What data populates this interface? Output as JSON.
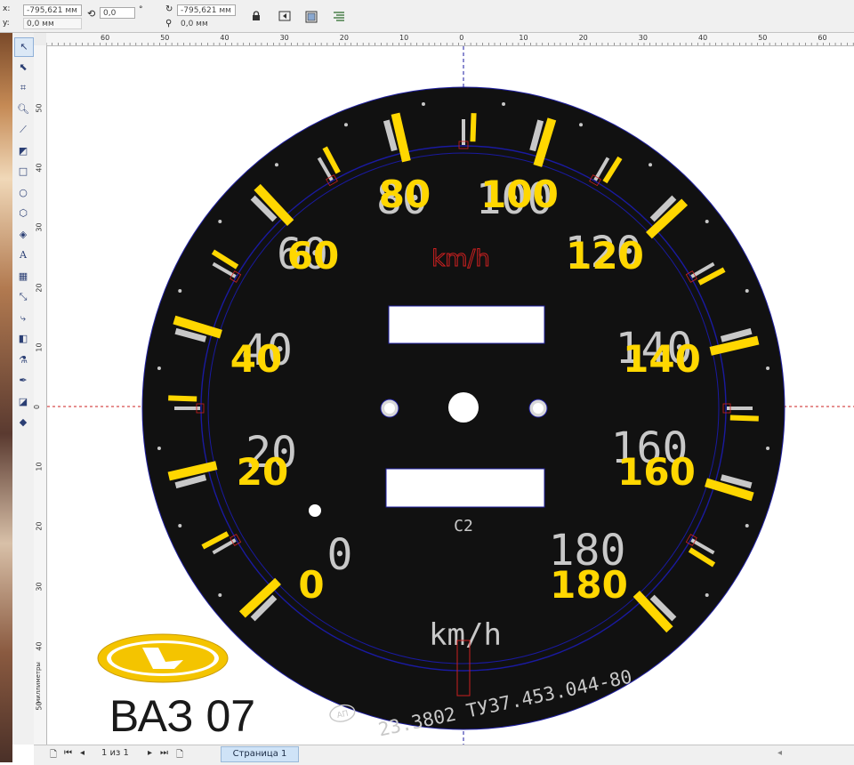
{
  "property_bar": {
    "x_label": "x:",
    "x_value": "-795,621 мм",
    "y_label": "y:",
    "y_value": "0,0 мм",
    "rotation_value": "0,0",
    "degree_symbol": "°",
    "node_x_value": "-795,621 мм",
    "node_y_value": "0,0 мм"
  },
  "rulers": {
    "horizontal_ticks": [
      "60",
      "50",
      "40",
      "30",
      "20",
      "10",
      "0",
      "10",
      "20",
      "30",
      "40",
      "50",
      "60"
    ],
    "vertical_ticks": [
      "50",
      "40",
      "30",
      "20",
      "10",
      "0",
      "10",
      "20",
      "30",
      "40",
      "50"
    ],
    "unit": "миллиметры"
  },
  "dial": {
    "kmh_top": "km/h",
    "kmh_bottom": "km/h",
    "model_code": "C2",
    "serial": "23.3802 ТУ37.453.044-80",
    "maker_mark": "АП",
    "yellow_numbers": [
      "0",
      "20",
      "40",
      "60",
      "80",
      "100",
      "120",
      "140",
      "160",
      "180"
    ],
    "printed_numbers": [
      "0",
      "20",
      "40",
      "60",
      "80",
      "100",
      "120",
      "140",
      "160",
      "180"
    ],
    "colors": {
      "face": "#111111",
      "yellow": "#ffd700",
      "printed": "#c8c8c8",
      "guide_red": "#cc2020",
      "guide_blue": "#1a1aa0"
    }
  },
  "logo": {
    "caption": "ВАЗ 07",
    "color": "#f4c400"
  },
  "status_bar": {
    "page_counter": "1 из 1",
    "page_tab": "Страница 1"
  }
}
